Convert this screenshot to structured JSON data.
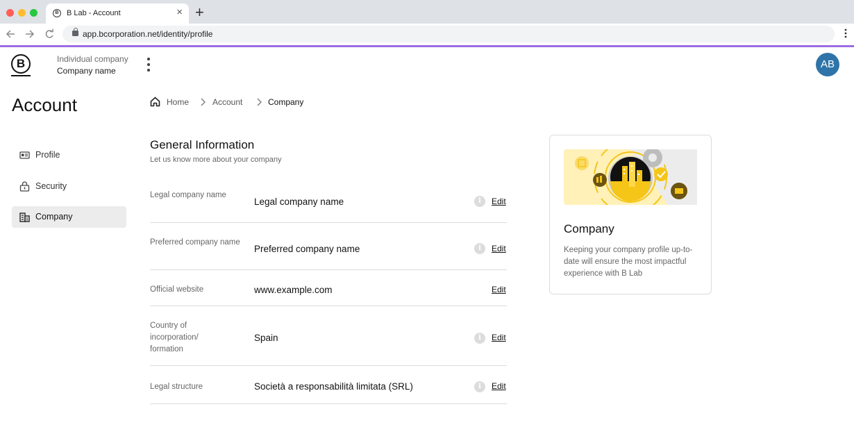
{
  "browser": {
    "tab_title": "B Lab - Account",
    "tab_favicon_letter": "B",
    "close_tab_glyph": "×",
    "new_tab_glyph": "+",
    "url": "app.bcorporation.net/identity/profile",
    "icons": [
      "back-arrow-icon",
      "forward-arrow-icon",
      "reload-icon",
      "lock-icon",
      "browser-menu-icon"
    ]
  },
  "header": {
    "logo_letter": "B",
    "company_type": "Individual company",
    "company_name": "Company name",
    "avatar_initials": "AB",
    "colors": {
      "accent_bar": "#9c6be3",
      "avatar": "#2f74a8"
    }
  },
  "sidebar": {
    "title": "Account",
    "items": [
      {
        "label": "Profile",
        "icon": "id-card-icon",
        "active": false
      },
      {
        "label": "Security",
        "icon": "padlock-icon",
        "active": false
      },
      {
        "label": "Company",
        "icon": "building-icon",
        "active": true
      }
    ]
  },
  "breadcrumb": {
    "home": "Home",
    "account": "Account",
    "current": "Company"
  },
  "general_information": {
    "title": "General Information",
    "subtitle": "Let us know more about your company",
    "edit_label": "Edit",
    "info_glyph": "i",
    "fields": [
      {
        "label": "Legal company name",
        "value": "Legal company name",
        "has_info": true
      },
      {
        "label": "Preferred company name",
        "value": "Preferred company name",
        "has_info": true
      },
      {
        "label": "Official website",
        "value": "www.example.com",
        "has_info": false
      },
      {
        "label": "Country of incorporation/ formation",
        "value": "Spain",
        "has_info": true
      },
      {
        "label": "Legal structure",
        "value": "Società a responsabilità limitata (SRL)",
        "has_info": true
      }
    ]
  },
  "card": {
    "illustration": "company-illustration",
    "title": "Company",
    "text": "Keeping your company profile up-to-date will ensure the most impactful experience with B Lab",
    "colors": {
      "illustration_bg": "#fff1b8",
      "illustration_accent": "#f5c518"
    }
  }
}
